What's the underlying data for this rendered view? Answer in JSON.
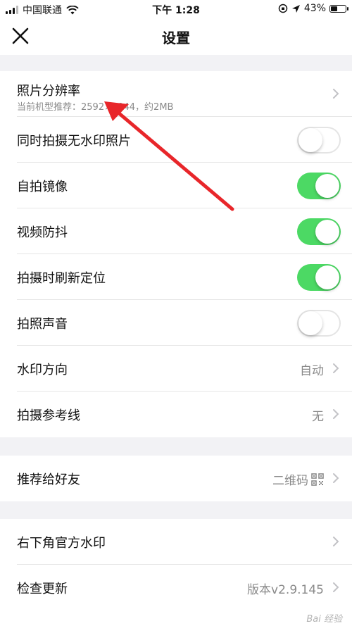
{
  "status_bar": {
    "carrier": "中国联通",
    "time": "下午 1:28",
    "battery_percent": "43%",
    "battery_level": 0.43,
    "icons": [
      "signal-icon",
      "wifi-icon",
      "lock-rotation-icon",
      "location-icon",
      "battery-icon"
    ]
  },
  "nav": {
    "title": "设置",
    "close_icon": "close-icon"
  },
  "groups": {
    "camera": {
      "photo_resolution": {
        "label": "照片分辨率",
        "sub": "当前机型推荐：2592×1944，约2MB"
      },
      "no_watermark": {
        "label": "同时拍摄无水印照片",
        "on": false
      },
      "selfie_mirror": {
        "label": "自拍镜像",
        "on": true
      },
      "video_stabilization": {
        "label": "视频防抖",
        "on": true
      },
      "refresh_location": {
        "label": "拍摄时刷新定位",
        "on": true
      },
      "shutter_sound": {
        "label": "拍照声音",
        "on": false
      },
      "watermark_direction": {
        "label": "水印方向",
        "value": "自动"
      },
      "guide_lines": {
        "label": "拍摄参考线",
        "value": "无"
      }
    },
    "share": {
      "recommend_friends": {
        "label": "推荐给好友",
        "value": "二维码"
      }
    },
    "about": {
      "official_watermark": {
        "label": "右下角官方水印"
      },
      "check_update": {
        "label": "检查更新",
        "value": "版本v2.9.145"
      }
    }
  },
  "colors": {
    "toggle_on": "#4cd964",
    "annotation_arrow": "#e8262a",
    "background": "#f2f2f5"
  },
  "watermark": "Bai 经验"
}
